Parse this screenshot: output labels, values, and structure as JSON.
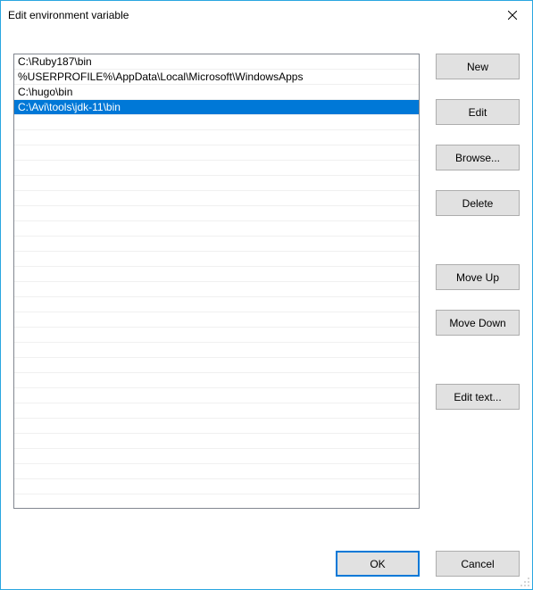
{
  "title": "Edit environment variable",
  "list": {
    "items": [
      "C:\\Ruby187\\bin",
      "%USERPROFILE%\\AppData\\Local\\Microsoft\\WindowsApps",
      "C:\\hugo\\bin",
      "C:\\Avi\\tools\\jdk-11\\bin"
    ],
    "selected_index": 3,
    "empty_rows": 26
  },
  "buttons": {
    "new": "New",
    "edit": "Edit",
    "browse": "Browse...",
    "delete": "Delete",
    "move_up": "Move Up",
    "move_down": "Move Down",
    "edit_text": "Edit text...",
    "ok": "OK",
    "cancel": "Cancel"
  }
}
